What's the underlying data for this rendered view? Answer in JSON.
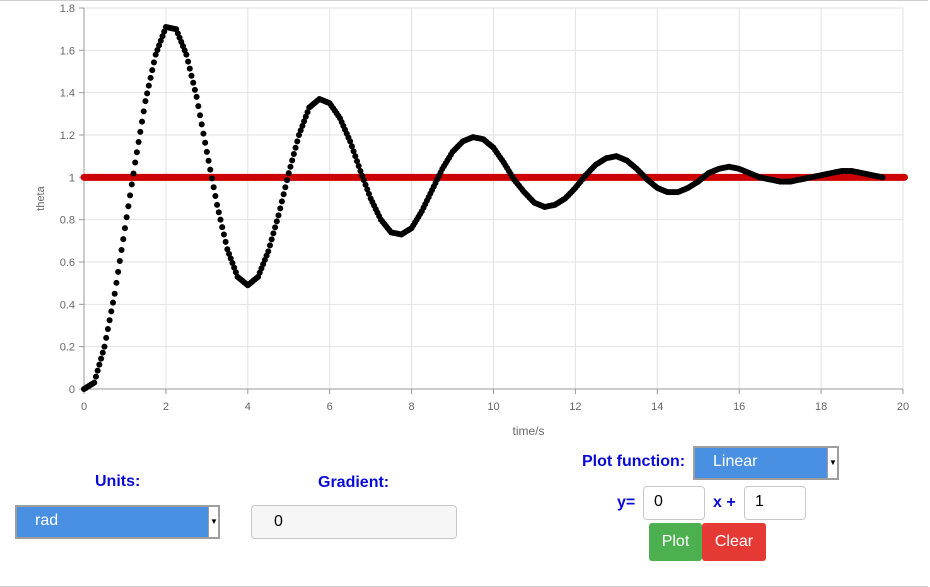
{
  "controls": {
    "units_label": "Units:",
    "units_value": "rad",
    "gradient_label": "Gradient:",
    "gradient_value": "0",
    "plot_function_label": "Plot function:",
    "plot_function_value": "Linear",
    "y_label": "y=",
    "slope_value": "0",
    "x_plus_label": "x +",
    "intercept_value": "1",
    "plot_button": "Plot",
    "clear_button": "Clear"
  },
  "colors": {
    "label_blue": "#0b0bd8",
    "select_blue": "#4a90e2",
    "plot_green": "#4caf50",
    "clear_red": "#e53935",
    "response_series": "#000000",
    "line_series": "#cc0000"
  },
  "chart_data": {
    "type": "scatter",
    "xlabel": "time/s",
    "ylabel": "theta",
    "xlim": [
      0,
      20
    ],
    "ylim": [
      0,
      1.8
    ],
    "xticks": [
      "0",
      "2",
      "4",
      "6",
      "8",
      "10",
      "12",
      "14",
      "16",
      "18",
      "20"
    ],
    "yticks": [
      "0",
      "0.2",
      "0.4",
      "0.6",
      "0.8",
      "1",
      "1.2",
      "1.4",
      "1.6",
      "1.8"
    ],
    "grid": true,
    "series": [
      {
        "kind": "points",
        "color": "#000000",
        "x": [
          0,
          0.25,
          0.5,
          0.75,
          1.0,
          1.25,
          1.5,
          1.75,
          2.0,
          2.25,
          2.5,
          2.75,
          3.0,
          3.25,
          3.5,
          3.75,
          4.0,
          4.25,
          4.5,
          4.75,
          5.0,
          5.25,
          5.5,
          5.75,
          6.0,
          6.25,
          6.5,
          6.75,
          7.0,
          7.25,
          7.5,
          7.75,
          8.0,
          8.25,
          8.5,
          8.75,
          9.0,
          9.25,
          9.5,
          9.75,
          10.0,
          10.25,
          10.5,
          10.75,
          11.0,
          11.25,
          11.5,
          11.75,
          12.0,
          12.25,
          12.5,
          12.75,
          13.0,
          13.25,
          13.5,
          13.75,
          14.0,
          14.25,
          14.5,
          14.75,
          15.0,
          15.25,
          15.5,
          15.75,
          16.0,
          16.25,
          16.5,
          16.75,
          17.0,
          17.25,
          17.5,
          17.75,
          18.0,
          18.25,
          18.5,
          18.75,
          19.0,
          19.25,
          19.5
        ],
        "y": [
          0,
          0.03,
          0.2,
          0.45,
          0.76,
          1.07,
          1.36,
          1.58,
          1.71,
          1.7,
          1.58,
          1.38,
          1.12,
          0.87,
          0.66,
          0.53,
          0.49,
          0.53,
          0.65,
          0.82,
          1.02,
          1.2,
          1.33,
          1.37,
          1.35,
          1.28,
          1.17,
          1.03,
          0.9,
          0.8,
          0.74,
          0.73,
          0.76,
          0.84,
          0.94,
          1.04,
          1.12,
          1.17,
          1.19,
          1.18,
          1.14,
          1.07,
          0.99,
          0.93,
          0.88,
          0.86,
          0.87,
          0.9,
          0.95,
          1.01,
          1.06,
          1.09,
          1.1,
          1.08,
          1.04,
          0.99,
          0.95,
          0.93,
          0.93,
          0.95,
          0.98,
          1.02,
          1.04,
          1.05,
          1.04,
          1.02,
          1.0,
          0.99,
          0.98,
          0.98,
          0.99,
          1.0,
          1.01,
          1.02,
          1.03,
          1.03,
          1.02,
          1.01,
          1.0
        ]
      },
      {
        "kind": "line",
        "color": "#cc0000",
        "x": [
          0,
          19.5
        ],
        "y": [
          1,
          1
        ]
      }
    ]
  }
}
